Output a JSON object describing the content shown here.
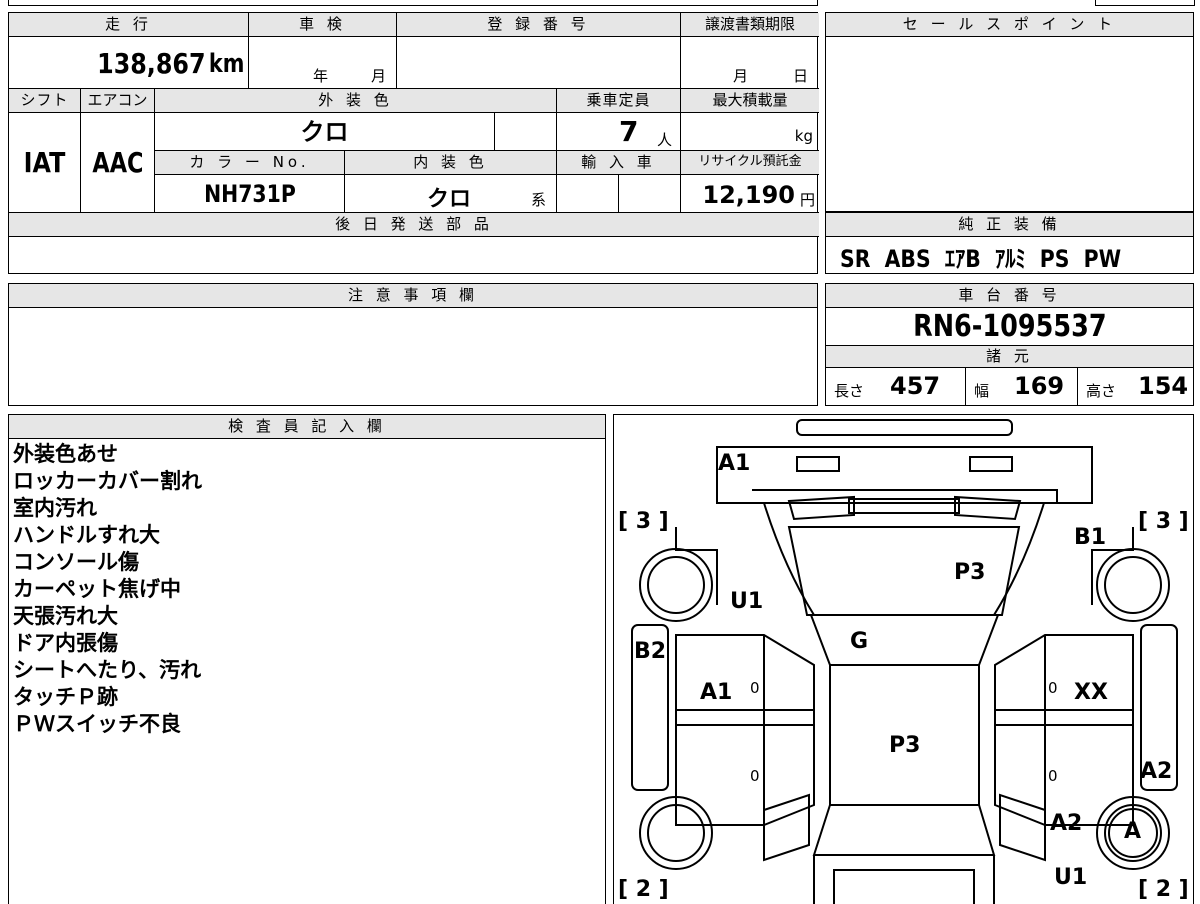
{
  "top_row_fragments": [
    "",
    "",
    ""
  ],
  "mileage": {
    "header": "走 行",
    "value": "138,867",
    "unit": "km"
  },
  "inspection": {
    "header": "車 検",
    "year": "年",
    "month": "月"
  },
  "registration": {
    "header": "登 録 番 号",
    "value": ""
  },
  "transfer_deadline": {
    "header": "譲渡書類期限",
    "month": "月",
    "day": "日"
  },
  "sales_point": {
    "header": "セ ー ル ス ポ イ ン ト",
    "value": ""
  },
  "shift": {
    "header": "シフト",
    "value": "IAT"
  },
  "aircon": {
    "header": "エアコン",
    "value": "AAC"
  },
  "exterior_color": {
    "header": "外 装 色",
    "value": "クロ"
  },
  "capacity": {
    "header": "乗車定員",
    "value": "7",
    "unit": "人"
  },
  "max_load": {
    "header": "最大積載量",
    "unit": "kg"
  },
  "color_no": {
    "header": "カ ラ ー No.",
    "value": "NH731P"
  },
  "interior_color": {
    "header": "内 装 色",
    "value": "クロ",
    "suffix": "系"
  },
  "import_car": {
    "header": "輸 入 車"
  },
  "recycle_fee": {
    "header": "リサイクル預託金",
    "value": "12,190",
    "unit": "円"
  },
  "deferred_parts": {
    "header": "後 日 発 送 部 品",
    "value": ""
  },
  "genuine_equipment": {
    "header": "純 正 装 備",
    "items": "SR  ABS  ｴｱB  ｱﾙﾐ  PS  PW"
  },
  "notes_field": {
    "header": "注 意 事 項 欄",
    "value": ""
  },
  "chassis_no": {
    "header": "車 台 番 号",
    "value": "RN6-1095537"
  },
  "specs": {
    "header": "諸 元",
    "length_label": "長さ",
    "length": "457",
    "width_label": "幅",
    "width": "169",
    "height_label": "高さ",
    "height": "154"
  },
  "inspector": {
    "header": "検 査 員 記 入 欄",
    "notes": [
      "外装色あせ",
      "ロッカーカバー割れ",
      "室内汚れ",
      "ハンドルすれ大",
      "コンソール傷",
      "カーペット焦げ中",
      "天張汚れ大",
      "ドア内張傷",
      "シートへたり、汚れ",
      "タッチＰ跡",
      "ＰＷスイッチ不良"
    ]
  },
  "diagram": {
    "labels": {
      "a1_front": "A1",
      "tire_fl": "[ 3 ]",
      "tire_fr": "[ 3 ]",
      "b1": "B1",
      "p3_hood": "P3",
      "u1_left": "U1",
      "g": "G",
      "b2": "B2",
      "a1_left": "A1",
      "xx": "XX",
      "p3_roof": "P3",
      "a2_right": "A2",
      "a2_rear": "A2",
      "a_circle": "A",
      "u1_rear": "U1",
      "tire_rl": "[ 2 ]",
      "tire_rr": "[ 2 ]",
      "zero": "0"
    }
  }
}
